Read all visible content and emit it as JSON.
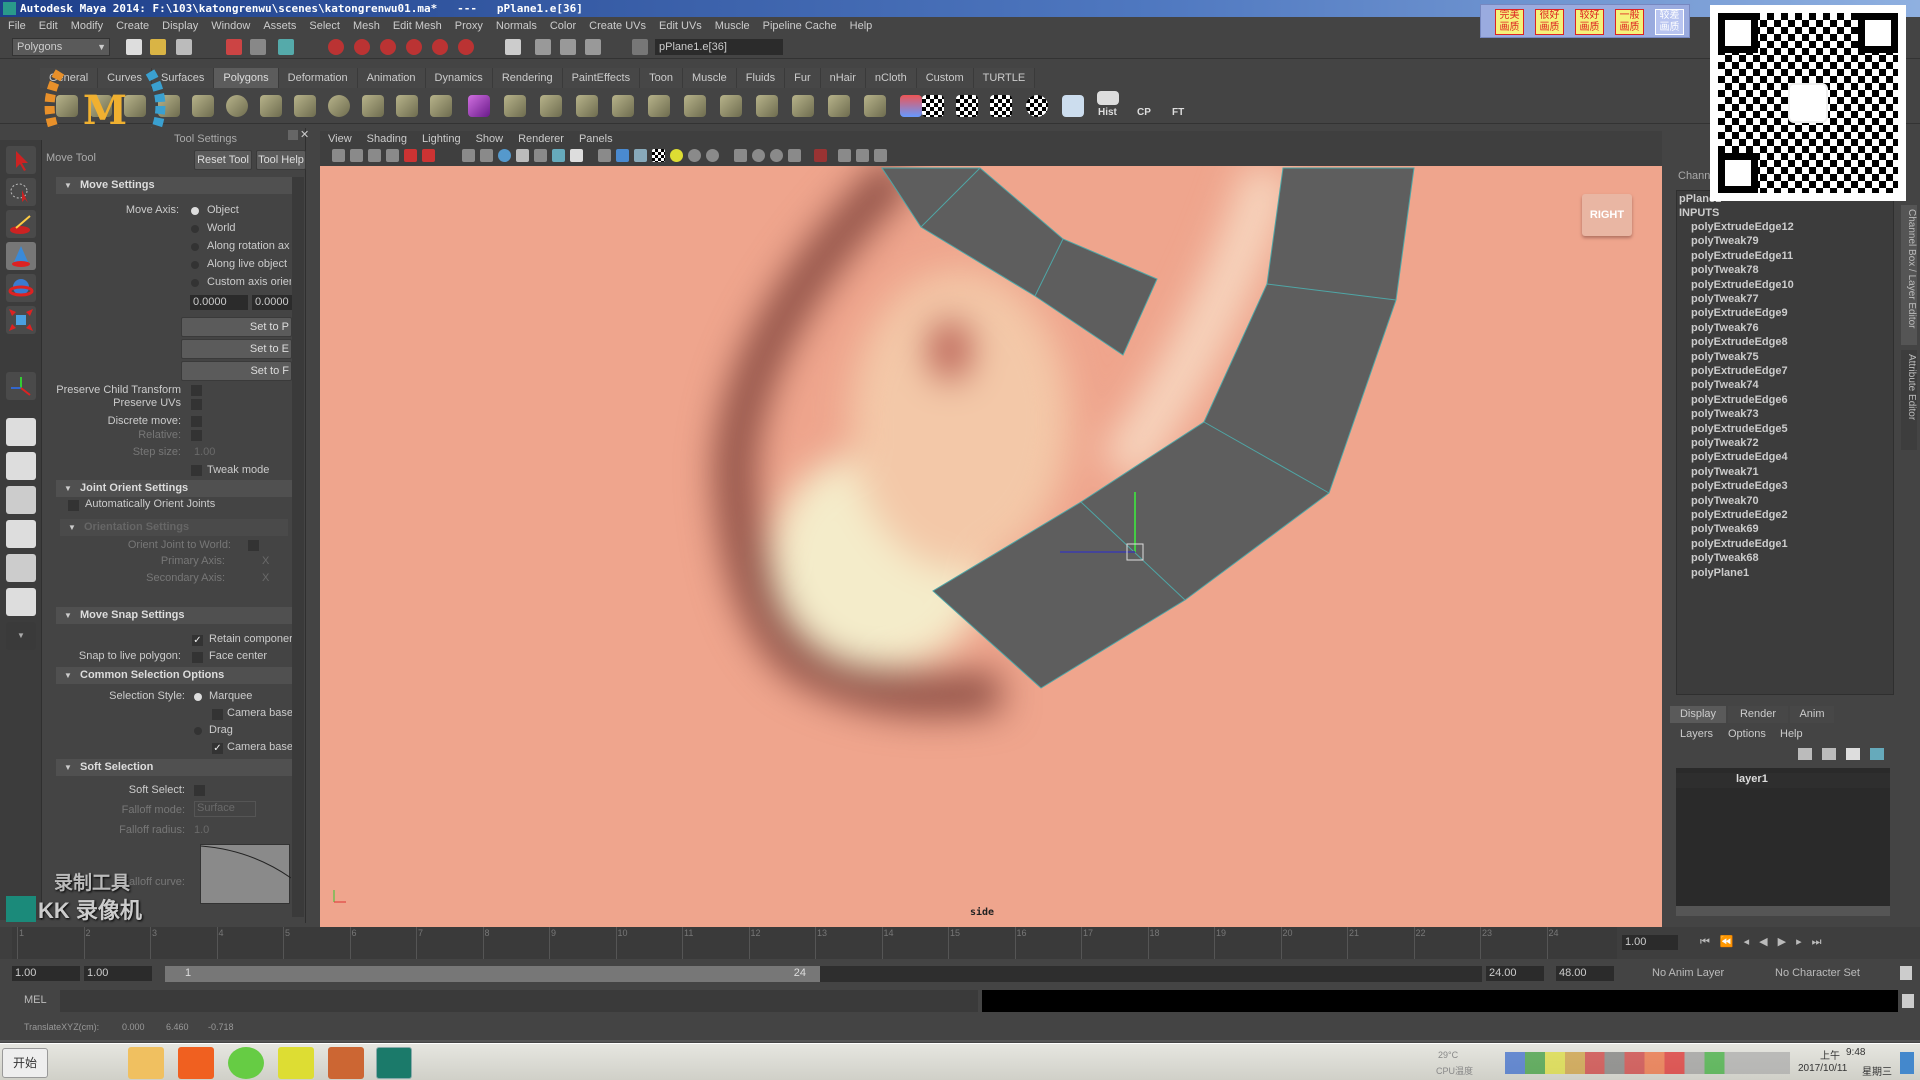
{
  "title_bar": {
    "text": "Autodesk Maya 2014: F:\\103\\katongrenwu\\scenes\\katongrenwu01.ma*   ---   pPlane1.e[36]"
  },
  "menu": [
    "File",
    "Edit",
    "Modify",
    "Create",
    "Display",
    "Window",
    "Assets",
    "Select",
    "Mesh",
    "Edit Mesh",
    "Proxy",
    "Normals",
    "Color",
    "Create UVs",
    "Edit UVs",
    "Muscle",
    "Pipeline Cache",
    "Help"
  ],
  "status_line": {
    "menu_set": "Polygons",
    "selection_field": "pPlane1.e[36]"
  },
  "shelf": {
    "tabs": [
      "General",
      "Curves",
      "Surfaces",
      "Polygons",
      "Deformation",
      "Animation",
      "Dynamics",
      "Rendering",
      "PaintEffects",
      "Toon",
      "Muscle",
      "Fluids",
      "Fur",
      "nHair",
      "nCloth",
      "Custom",
      "TURTLE"
    ],
    "active_tab": "Polygons",
    "text_buttons": [
      "Hist",
      "CP",
      "FT"
    ]
  },
  "tool_settings": {
    "header": "Tool Settings",
    "tool_name": "Move Tool",
    "reset_label": "Reset Tool",
    "help_label": "Tool Help",
    "move_settings": {
      "title": "Move Settings",
      "move_axis_label": "Move Axis:",
      "axis_options": [
        "Object",
        "World",
        "Along rotation ax",
        "Along live object",
        "Custom axis orier"
      ],
      "selected_axis": "Object",
      "custom_values": [
        "0.0000",
        "0.0000"
      ],
      "set_buttons": [
        "Set to P",
        "Set to E",
        "Set to F"
      ],
      "preserve_child": "Preserve Child Transform",
      "preserve_uvs": "Preserve UVs",
      "discrete_move": "Discrete move:",
      "relative": "Relative:",
      "step_size": "Step size:",
      "step_value": "1.00",
      "tweak_mode": "Tweak mode"
    },
    "joint_orient": {
      "title": "Joint Orient Settings",
      "auto_orient": "Automatically Orient Joints",
      "orientation_title": "Orientation Settings",
      "orient_world": "Orient Joint to World:",
      "primary_axis": "Primary Axis:",
      "secondary_axis": "Secondary Axis:",
      "axis_value": "X"
    },
    "move_snap": {
      "title": "Move Snap Settings",
      "retain": "Retain componer",
      "snap_live_label": "Snap to live polygon:",
      "face_center": "Face center"
    },
    "common_selection": {
      "title": "Common Selection Options",
      "style_label": "Selection Style:",
      "marquee": "Marquee",
      "camera_base_1": "Camera base",
      "drag": "Drag",
      "camera_base_2": "Camera base"
    },
    "soft_selection": {
      "title": "Soft Selection",
      "soft_select_label": "Soft Select:",
      "falloff_mode_label": "Falloff mode:",
      "falloff_mode_value": "Surface",
      "falloff_radius_label": "Falloff radius:",
      "falloff_radius_value": "1.0",
      "curve_label": "Falloff curve:"
    }
  },
  "watermark": {
    "recorder": "录制工具",
    "brand": "KK 录像机",
    "logo_text": "Maya"
  },
  "viewport": {
    "menu": [
      "View",
      "Shading",
      "Lighting",
      "Show",
      "Renderer",
      "Panels"
    ],
    "camera_label": "side",
    "view_cube": "RIGHT"
  },
  "channel_box": {
    "tab_label": "Channel Box / Layer Editor",
    "side_tab": "Attribute Editor",
    "header": "Chann",
    "object": "pPlane1",
    "inputs_label": "INPUTS",
    "inputs": [
      "polyExtrudeEdge12",
      "polyTweak79",
      "polyExtrudeEdge11",
      "polyTweak78",
      "polyExtrudeEdge10",
      "polyTweak77",
      "polyExtrudeEdge9",
      "polyTweak76",
      "polyExtrudeEdge8",
      "polyTweak75",
      "polyExtrudeEdge7",
      "polyTweak74",
      "polyExtrudeEdge6",
      "polyTweak73",
      "polyExtrudeEdge5",
      "polyTweak72",
      "polyExtrudeEdge4",
      "polyTweak71",
      "polyExtrudeEdge3",
      "polyTweak70",
      "polyExtrudeEdge2",
      "polyTweak69",
      "polyExtrudeEdge1",
      "polyTweak68",
      "polyPlane1"
    ]
  },
  "layer_editor": {
    "tabs": [
      "Display",
      "Render",
      "Anim"
    ],
    "active_tab": "Display",
    "menu": [
      "Layers",
      "Options",
      "Help"
    ],
    "layers": [
      "layer1"
    ]
  },
  "timeline": {
    "ticks": [
      "1",
      "2",
      "3",
      "4",
      "5",
      "6",
      "7",
      "8",
      "9",
      "10",
      "11",
      "12",
      "13",
      "14",
      "15",
      "16",
      "17",
      "18",
      "19",
      "20",
      "21",
      "22",
      "23",
      "24"
    ],
    "current_frame": "1.00"
  },
  "range": {
    "start": "1.00",
    "playback_start": "1.00",
    "slider_start": "1",
    "slider_end": "24",
    "playback_end": "24.00",
    "end": "48.00",
    "anim_layer": "No Anim Layer",
    "character_set": "No Character Set"
  },
  "command_line": {
    "label": "MEL"
  },
  "help_line": {
    "label": "TranslateXYZ(cm):",
    "values": [
      "0.000",
      "6.460",
      "-0.718"
    ]
  },
  "quality_bar": [
    "完美画质",
    "很好画质",
    "较好画质",
    "一般画质",
    "较差画质"
  ],
  "taskbar": {
    "start": "开始",
    "temperature": "29°C",
    "cpu": "CPU温度",
    "time_period": "上午",
    "time": "9:48",
    "date": "2017/10/11",
    "weekday": "星期三"
  },
  "colors": {
    "viewport_bg": "#efa58d",
    "mesh": "#5e5e5e",
    "panel": "#444444",
    "titlebar": "#1e3f8a"
  }
}
